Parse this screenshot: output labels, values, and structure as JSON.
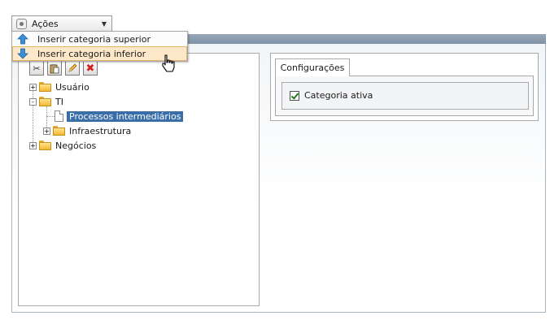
{
  "actions": {
    "label": "Ações",
    "menu": [
      {
        "label": "Inserir categoria superior",
        "icon": "arrow-up-icon",
        "color": "#3b8fd9"
      },
      {
        "label": "Inserir categoria inferior",
        "icon": "arrow-down-icon",
        "color": "#3b8fd9",
        "hovered": true
      }
    ]
  },
  "toolbar": {
    "buttons": [
      {
        "icon": "scissors-icon"
      },
      {
        "icon": "paste-icon"
      },
      {
        "icon": "pencil-icon"
      },
      {
        "icon": "delete-icon"
      }
    ]
  },
  "tree": {
    "nodes": [
      {
        "label": "Usuário",
        "expander": "+"
      },
      {
        "label": "TI",
        "expander": "-"
      },
      {
        "label": "Processos intermediários",
        "selected": true
      },
      {
        "label": "Infraestrutura",
        "expander": "+"
      },
      {
        "label": "Negócios",
        "expander": "+"
      }
    ]
  },
  "config": {
    "tab_label": "Configurações",
    "checkbox_label": "Categoria ativa",
    "checked": true
  },
  "colors": {
    "header_bar": "#8b9bad",
    "selection": "#3a6ea8",
    "menu_hover": "#fde9c9"
  }
}
